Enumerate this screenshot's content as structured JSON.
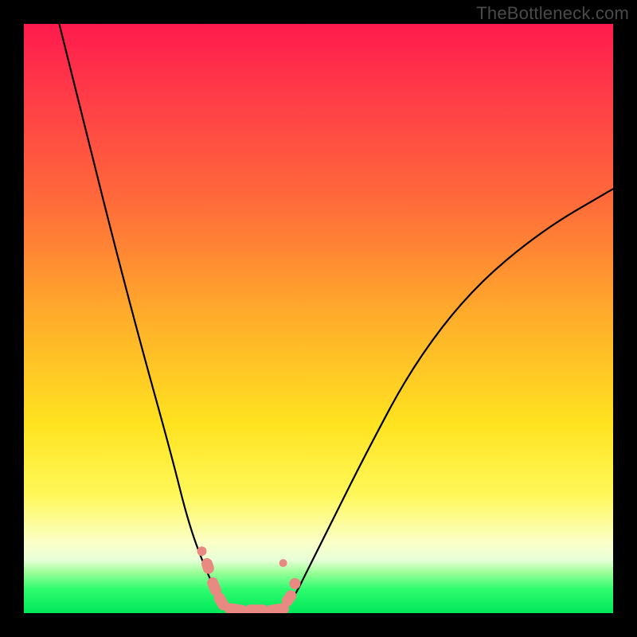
{
  "watermark": "TheBottleneck.com",
  "chart_data": {
    "type": "line",
    "title": "",
    "xlabel": "",
    "ylabel": "",
    "xlim": [
      0,
      100
    ],
    "ylim": [
      0,
      100
    ],
    "series": [
      {
        "name": "curve-left",
        "x": [
          6,
          10,
          15,
          20,
          25,
          28,
          31,
          33,
          35
        ],
        "y": [
          100,
          84,
          64,
          45,
          27,
          15,
          7,
          3,
          0
        ]
      },
      {
        "name": "curve-right",
        "x": [
          44,
          46,
          48,
          52,
          58,
          66,
          76,
          88,
          100
        ],
        "y": [
          0,
          3,
          7,
          15,
          27,
          42,
          55,
          65,
          72
        ]
      },
      {
        "name": "markers-left",
        "x": [
          31,
          32,
          33,
          33.5,
          34,
          35,
          36,
          37,
          38
        ],
        "y": [
          7,
          5,
          3,
          2,
          1.5,
          0.8,
          0.5,
          0.5,
          0.5
        ]
      },
      {
        "name": "markers-right",
        "x": [
          40,
          41,
          42,
          43,
          44,
          45,
          46
        ],
        "y": [
          0.5,
          0.5,
          0.5,
          0.8,
          1.5,
          3,
          5
        ]
      }
    ],
    "marker_color": "#e88a82",
    "line_color": "#000000",
    "background_gradient": [
      "#ff1a4d",
      "#ffae2a",
      "#fff85a",
      "#00e85a"
    ]
  }
}
